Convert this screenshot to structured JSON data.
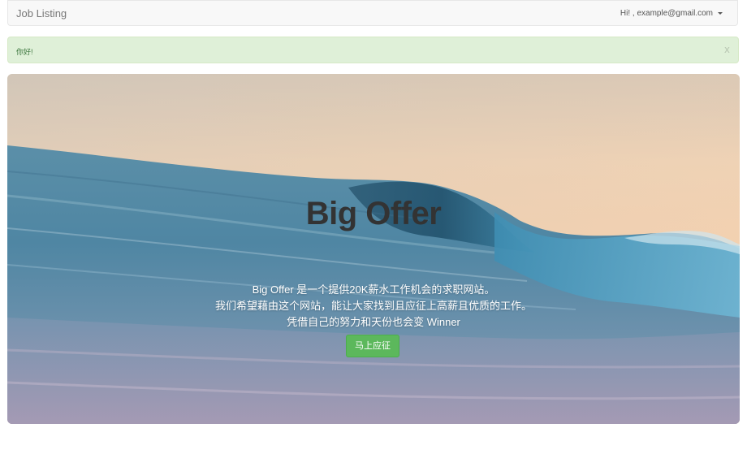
{
  "navbar": {
    "brand": "Job Listing",
    "user_label": "Hi! , example@gmail.com"
  },
  "alert": {
    "message": "你好!",
    "close_label": "x"
  },
  "hero": {
    "title": "Big Offer",
    "line1": "Big Offer 是一个提供20K薪水工作机会的求职网站。",
    "line2": "我们希望藉由这个网站，能让大家找到且应征上高薪且优质的工作。",
    "line3": "凭借自己的努力和天份也会变 Winner",
    "cta_label": "马上应征"
  },
  "colors": {
    "alert_bg": "#dff0d8",
    "cta": "#5cb85c"
  }
}
